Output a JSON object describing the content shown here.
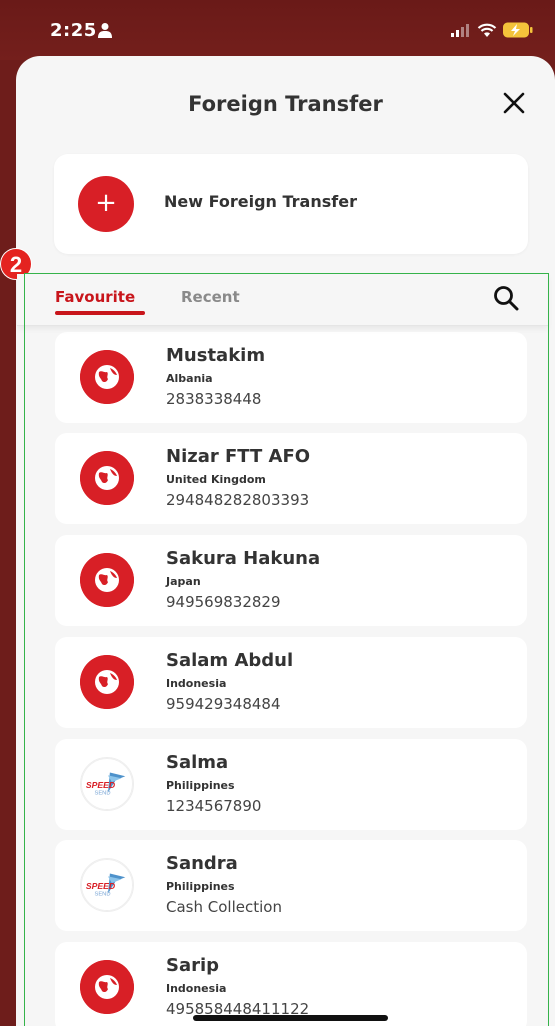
{
  "status": {
    "time": "2:25"
  },
  "header": {
    "title": "Foreign Transfer"
  },
  "new_transfer": {
    "label": "New Foreign Transfer",
    "icon": "+"
  },
  "annotation": {
    "badge": "2"
  },
  "tabs": [
    {
      "label": "Favourite",
      "active": true
    },
    {
      "label": "Recent",
      "active": false
    }
  ],
  "recipients": [
    {
      "name": "Mustakim",
      "country": "Albania",
      "account": "2838338448",
      "icon": "globe-icon"
    },
    {
      "name": "Nizar FTT AFO",
      "country": "United Kingdom",
      "account": "294848282803393",
      "icon": "globe-icon"
    },
    {
      "name": "Sakura Hakuna",
      "country": "Japan",
      "account": "949569832829",
      "icon": "globe-icon"
    },
    {
      "name": "Salam Abdul",
      "country": "Indonesia",
      "account": "959429348484",
      "icon": "globe-icon"
    },
    {
      "name": "Salma",
      "country": "Philippines",
      "account": "1234567890",
      "icon": "speedsend-logo"
    },
    {
      "name": "Sandra",
      "country": "Philippines",
      "account": "Cash Collection",
      "icon": "speedsend-logo"
    },
    {
      "name": "Sarip",
      "country": "Indonesia",
      "account": "495858448411122",
      "icon": "globe-icon"
    }
  ],
  "logo_text": {
    "speed": "SPEED",
    "send": "SEND"
  },
  "colors": {
    "accent": "#d81f26",
    "status_bar": "#6e1d1b",
    "frame": "#35b34a"
  }
}
